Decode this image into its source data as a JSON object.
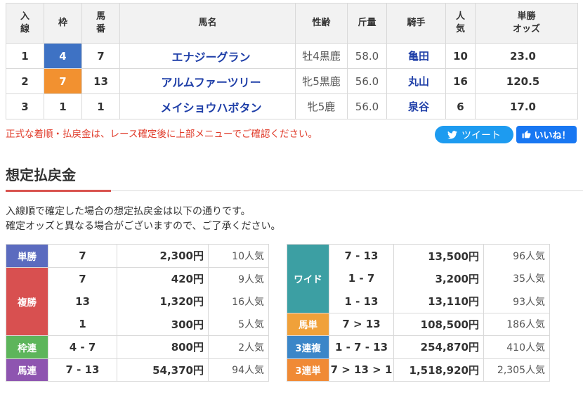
{
  "result_table": {
    "headers": {
      "pos": "入\n線",
      "waku": "枠",
      "umaban": "馬\n番",
      "horse": "馬名",
      "sexage": "性齢",
      "weight": "斤量",
      "jockey": "騎手",
      "popularity": "人\n気",
      "odds": "単勝\nオッズ"
    },
    "rows": [
      {
        "pos": "1",
        "waku": "4",
        "umaban": "7",
        "horse": "エナジーグラン",
        "sexage": "牡4黒鹿",
        "weight": "58.0",
        "jockey": "亀田",
        "popularity": "10",
        "odds": "23.0"
      },
      {
        "pos": "2",
        "waku": "7",
        "umaban": "13",
        "horse": "アルムファーツリー",
        "sexage": "牝5黒鹿",
        "weight": "56.0",
        "jockey": "丸山",
        "popularity": "16",
        "odds": "120.5"
      },
      {
        "pos": "3",
        "waku": "1",
        "umaban": "1",
        "horse": "メイショウハボタン",
        "sexage": "牝5鹿",
        "weight": "56.0",
        "jockey": "泉谷",
        "popularity": "6",
        "odds": "17.0"
      }
    ]
  },
  "notice": "正式な着順・払戻金は、レース確定後に上部メニューでご確認ください。",
  "share": {
    "tweet_label": "ツイート",
    "like_label": "いいね！"
  },
  "section": {
    "title": "想定払戻金",
    "desc_line1": "入線順で確定した場合の想定払戻金は以下の通りです。",
    "desc_line2": "確定オッズと異なる場合がございますので、ご了承ください。"
  },
  "payouts_left": {
    "tansho": {
      "label": "単勝",
      "rows": [
        {
          "combo": "7",
          "amount": "2,300円",
          "ninki": "10人気"
        }
      ]
    },
    "fukusho": {
      "label": "複勝",
      "rows": [
        {
          "combo": "7",
          "amount": "420円",
          "ninki": "9人気"
        },
        {
          "combo": "13",
          "amount": "1,320円",
          "ninki": "16人気"
        },
        {
          "combo": "1",
          "amount": "300円",
          "ninki": "5人気"
        }
      ]
    },
    "wakuren": {
      "label": "枠連",
      "rows": [
        {
          "combo": "4 - 7",
          "amount": "800円",
          "ninki": "2人気"
        }
      ]
    },
    "umaren": {
      "label": "馬連",
      "rows": [
        {
          "combo": "7 - 13",
          "amount": "54,370円",
          "ninki": "94人気"
        }
      ]
    }
  },
  "payouts_right": {
    "wide": {
      "label": "ワイド",
      "rows": [
        {
          "combo": "7 - 13",
          "amount": "13,500円",
          "ninki": "96人気"
        },
        {
          "combo": "1 - 7",
          "amount": "3,200円",
          "ninki": "35人気"
        },
        {
          "combo": "1 - 13",
          "amount": "13,110円",
          "ninki": "93人気"
        }
      ]
    },
    "umatan": {
      "label": "馬単",
      "rows": [
        {
          "combo": "7 > 13",
          "amount": "108,500円",
          "ninki": "186人気"
        }
      ]
    },
    "sanrenpuku": {
      "label": "3連複",
      "rows": [
        {
          "combo": "1 - 7 - 13",
          "amount": "254,870円",
          "ninki": "410人気"
        }
      ]
    },
    "sanrentan": {
      "label": "3連単",
      "rows": [
        {
          "combo": "7 > 13 > 1",
          "amount": "1,518,920円",
          "ninki": "2,305人気"
        }
      ]
    }
  },
  "colors": {
    "waku4": "#3e72c4",
    "waku7": "#f29130",
    "link": "#1f3fa8",
    "notice": "#e03b2a",
    "tweet": "#1d9bf0",
    "like": "#1877f2"
  }
}
